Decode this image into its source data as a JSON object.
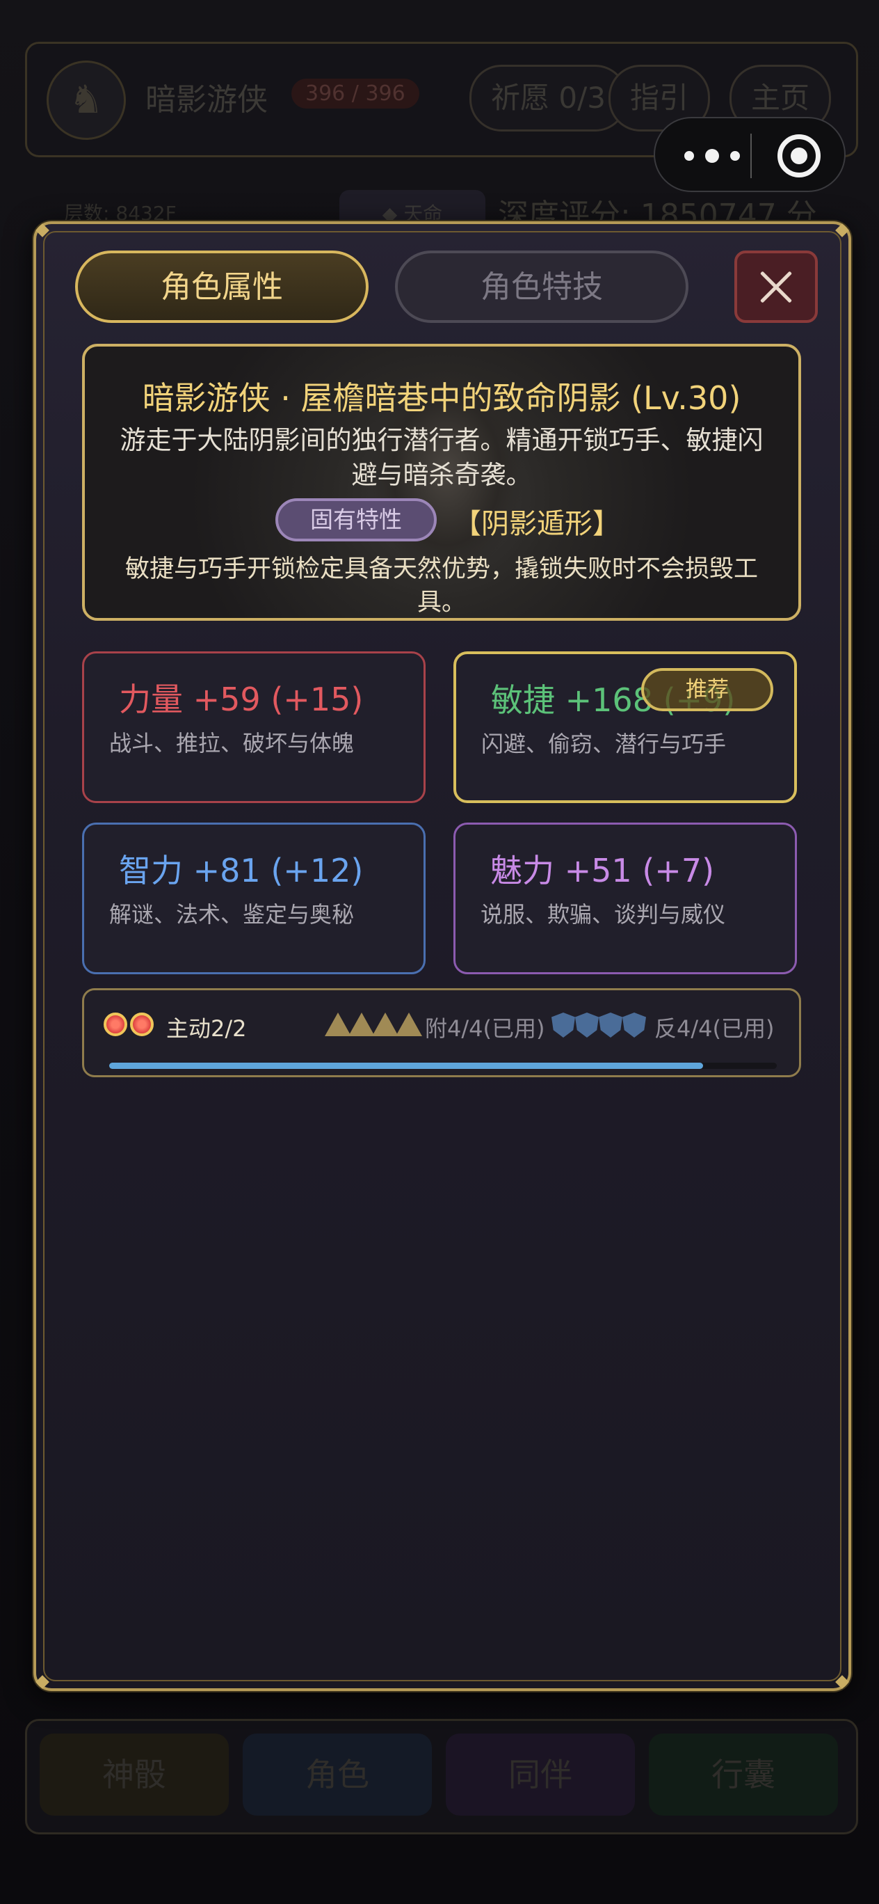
{
  "background": {
    "title": "暗影游侠",
    "hp": "396 / 396",
    "pills": [
      "祈愿 0/3",
      "指引",
      "主页"
    ],
    "layer_text": "层数: 8432F",
    "mid_button": "◆ 天命",
    "score_text": "深度评分: 1850747 分",
    "bottom_tabs": [
      "神骰",
      "角色",
      "同伴",
      "行囊"
    ]
  },
  "modal": {
    "tabs": {
      "active": "角色属性",
      "inactive": "角色特技"
    },
    "hero": {
      "title": "暗影游侠 · 屋檐暗巷中的致命阴影 (Lv.30)",
      "description": "游走于大陆阴影间的独行潜行者。精通开锁巧手、敏捷闪避与暗杀奇袭。",
      "trait_badge": "固有特性",
      "trait_name": "【阴影遁形】",
      "trait_desc": "敏捷与巧手开锁检定具备天然优势，撬锁失败时不会损毁工具。"
    },
    "stats": [
      {
        "name": "力量",
        "value": "+59 (+15)",
        "desc": "战斗、推拉、破坏与体魄",
        "color": "#e2595f"
      },
      {
        "name": "敏捷",
        "value": "+168 (+9)",
        "desc": "闪避、偷窃、潜行与巧手",
        "color": "#5cc279",
        "badge": "推荐"
      },
      {
        "name": "智力",
        "value": "+81 (+12)",
        "desc": "解谜、法术、鉴定与奥秘",
        "color": "#6aa4ef"
      },
      {
        "name": "魅力",
        "value": "+51 (+7)",
        "desc": "说服、欺骗、谈判与威仪",
        "color": "#c88ae6"
      }
    ],
    "status": {
      "active_label": "主动2/2",
      "attach_label": "附4/4(已用)",
      "counter_label": "反4/4(已用)",
      "progress": 0.89
    }
  },
  "capsule": {
    "icons": [
      "more-dots-icon",
      "record-target-icon"
    ]
  }
}
